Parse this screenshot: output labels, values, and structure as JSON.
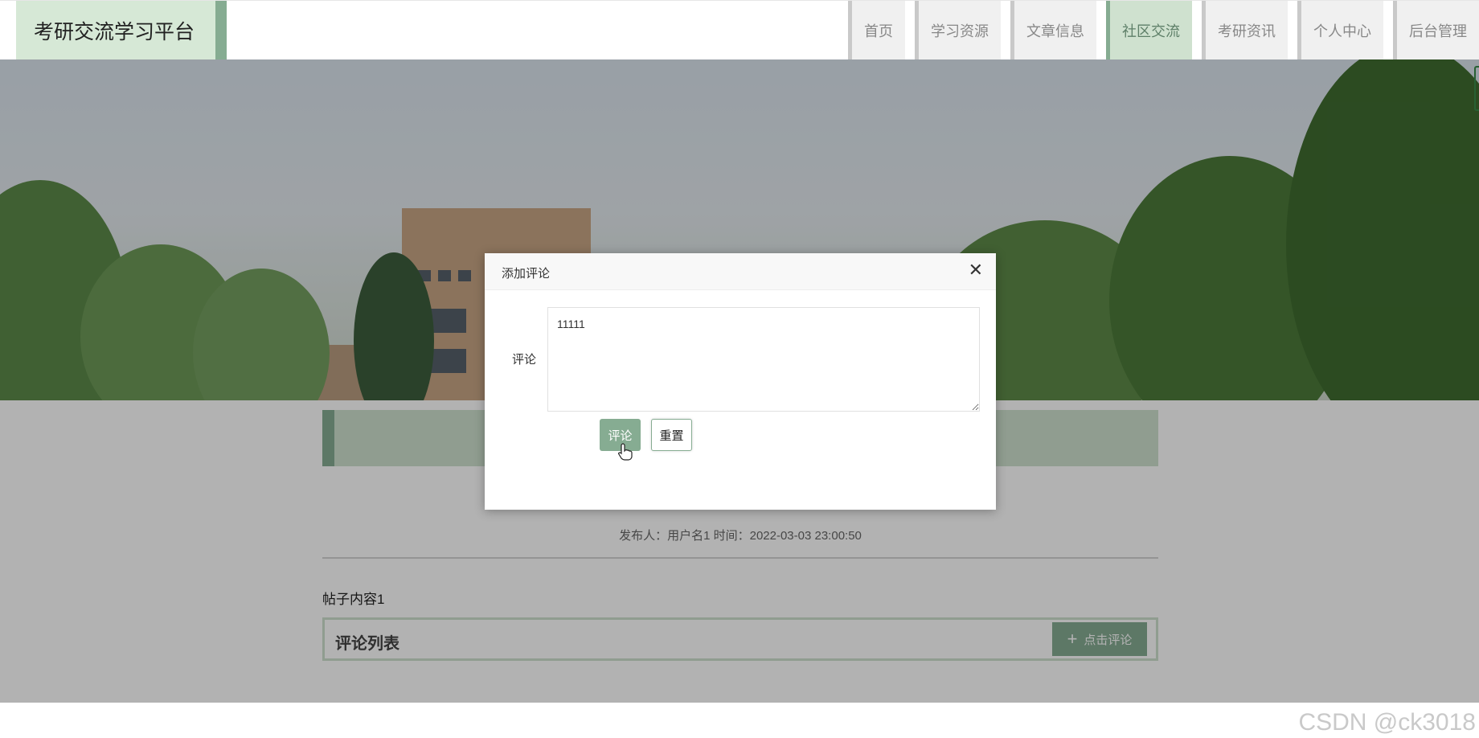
{
  "header": {
    "logo_text": "考研交流学习平台",
    "nav": [
      {
        "label": "首页"
      },
      {
        "label": "学习资源"
      },
      {
        "label": "文章信息"
      },
      {
        "label": "社区交流",
        "active": true
      },
      {
        "label": "考研资讯"
      },
      {
        "label": "个人中心"
      },
      {
        "label": "后台管理"
      }
    ]
  },
  "post": {
    "meta": "发布人：用户名1 时间：2022-03-03 23:00:50",
    "content": "帖子内容1"
  },
  "comments": {
    "list_title": "评论列表",
    "add_button_label": "点击评论",
    "add_button_icon": "plus-icon"
  },
  "modal": {
    "title": "添加评论",
    "close_icon": "close-icon",
    "field_label": "评论",
    "textarea_value": "11111",
    "submit_label": "评论",
    "reset_label": "重置"
  },
  "watermark": "CSDN @ck3018",
  "colors": {
    "accent": "#86ac92",
    "accent_light": "#cfe1cf",
    "logo_bg": "#d6e8d6"
  }
}
